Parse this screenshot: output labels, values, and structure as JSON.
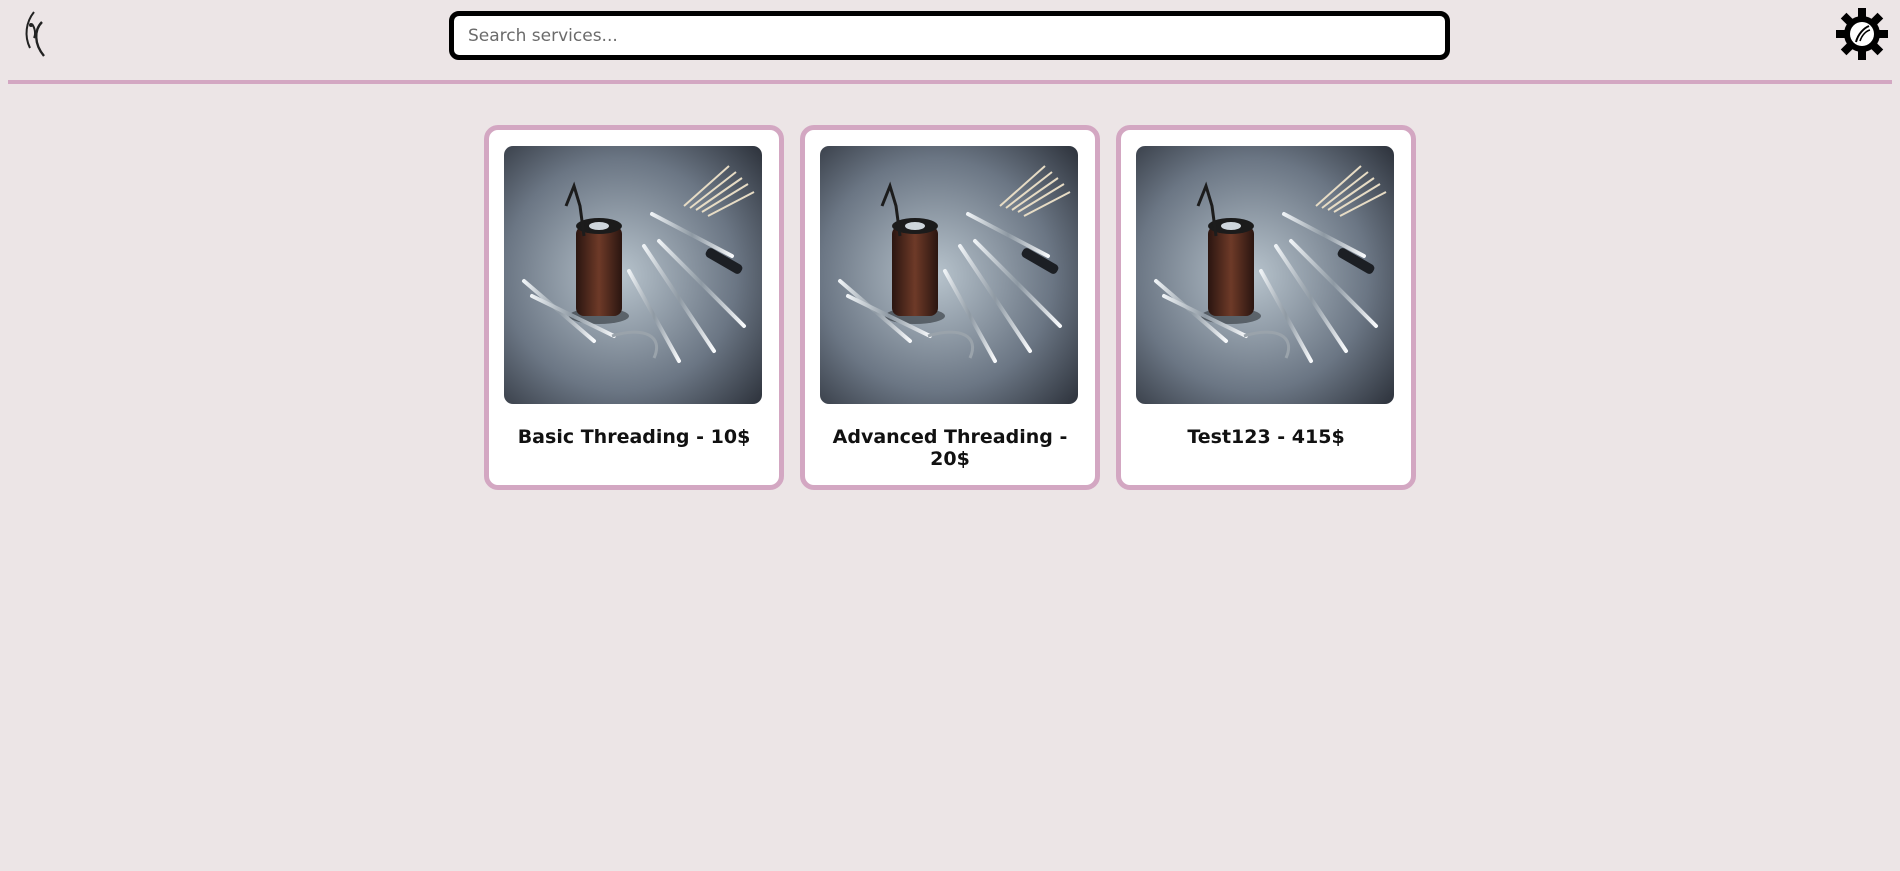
{
  "header": {
    "logo_icon": "salon-logo-icon",
    "search_placeholder": "Search services...",
    "search_value": "",
    "settings_icon": "gear-icon"
  },
  "colors": {
    "background": "#ece5e6",
    "accent": "#d3a7c2",
    "card_bg": "#ffffff",
    "search_border": "#000000"
  },
  "services": [
    {
      "title": "Basic Threading - 10$",
      "image": "threading-tools-image"
    },
    {
      "title": "Advanced Threading - 20$",
      "image": "threading-tools-image"
    },
    {
      "title": "Test123 - 415$",
      "image": "threading-tools-image"
    }
  ]
}
